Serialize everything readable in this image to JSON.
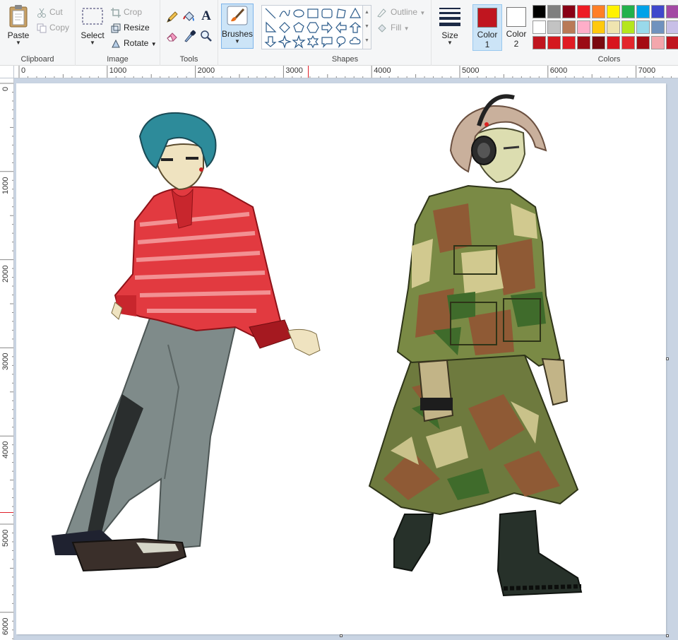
{
  "clipboard": {
    "group_label": "Clipboard",
    "paste_label": "Paste",
    "cut_label": "Cut",
    "copy_label": "Copy"
  },
  "image": {
    "group_label": "Image",
    "select_label": "Select",
    "crop_label": "Crop",
    "resize_label": "Resize",
    "rotate_label": "Rotate"
  },
  "tools": {
    "group_label": "Tools",
    "items": [
      "pencil-icon",
      "fill-bucket-icon",
      "text-icon",
      "eraser-icon",
      "color-picker-icon",
      "magnifier-icon"
    ],
    "text_glyph": "A"
  },
  "brushes": {
    "label": "Brushes"
  },
  "shapes": {
    "group_label": "Shapes",
    "outline_label": "Outline",
    "fill_label": "Fill"
  },
  "size": {
    "label": "Size"
  },
  "colors": {
    "group_label": "Colors",
    "color1_label": "Color",
    "color1_sub": "1",
    "color2_label": "Color",
    "color2_sub": "2",
    "color1_value": "#c0151f",
    "color2_value": "#ffffff",
    "palette_row1": [
      "#000000",
      "#7f7f7f",
      "#880015",
      "#ed1c24",
      "#ff7f27",
      "#fff200",
      "#22b14c",
      "#00a2e8",
      "#3f48cc",
      "#a349a4"
    ],
    "palette_row2": [
      "#ffffff",
      "#c3c3c3",
      "#b97a57",
      "#ffaec9",
      "#ffc90e",
      "#efe4b0",
      "#b5e61d",
      "#99d9ea",
      "#7092be",
      "#c8bfe7"
    ],
    "palette_row3": [
      "#c0151f",
      "#d4191f",
      "#e01b24",
      "#9b0b14",
      "#7a0a10",
      "#d8141d",
      "#e3262c",
      "#a50a12",
      "#f3a6ac",
      "#c0151f"
    ]
  },
  "ruler": {
    "h_labels": [
      "0",
      "1000",
      "2000",
      "3000",
      "4000",
      "5000",
      "6000",
      "7000"
    ],
    "v_labels": [
      "0",
      "1000",
      "2000",
      "3000",
      "4000",
      "5000",
      "6000"
    ]
  },
  "accent": "#0078d7"
}
